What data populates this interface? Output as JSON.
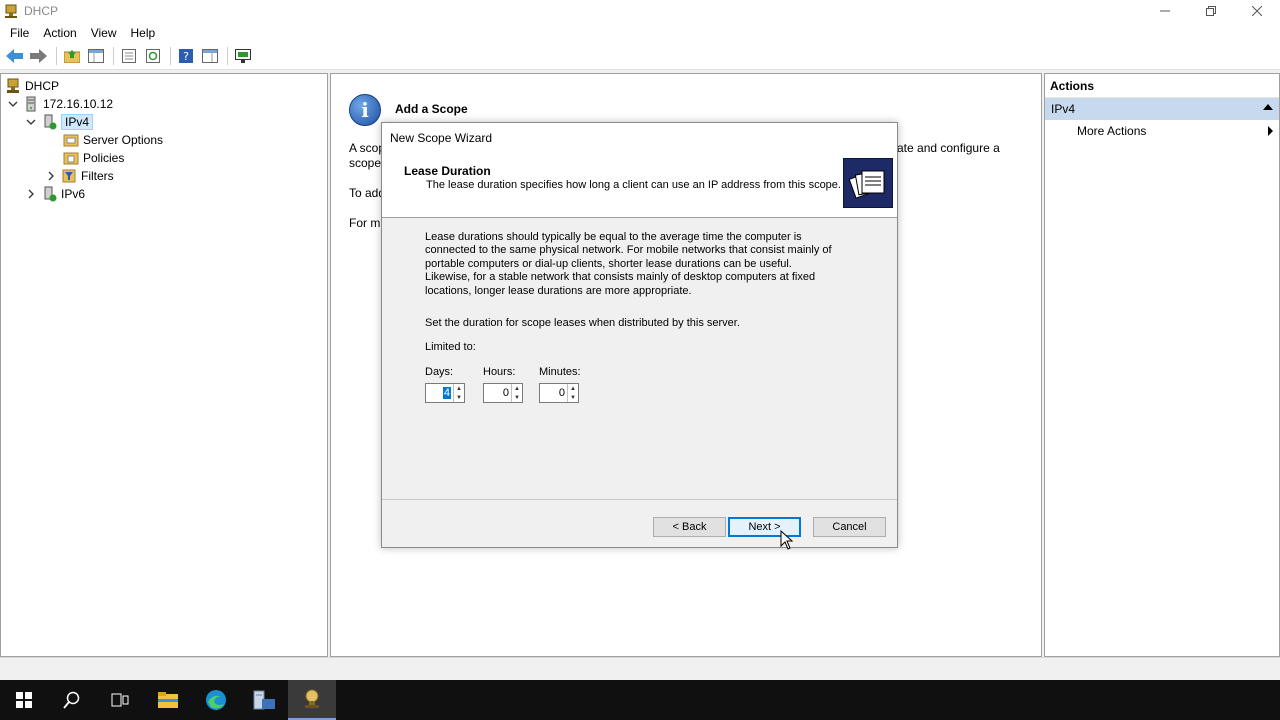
{
  "window": {
    "title": "DHCP",
    "controls": [
      "minimize",
      "restore",
      "close"
    ]
  },
  "menu": [
    "File",
    "Action",
    "View",
    "Help"
  ],
  "toolbar": {
    "buttons": [
      "back-icon",
      "forward-icon",
      "up-folder-icon",
      "show-hide-console-tree-icon",
      "properties-icon",
      "refresh-icon",
      "help-icon",
      "show-hide-action-pane-icon",
      "monitor-icon"
    ]
  },
  "tree": {
    "root": "DHCP",
    "server": "172.16.10.12",
    "ipv4": "IPv4",
    "server_options": "Server Options",
    "policies": "Policies",
    "filters": "Filters",
    "ipv6": "IPv6"
  },
  "center": {
    "title": "Add a Scope",
    "line1_left": "A scop",
    "line1_right": "ate and configure a",
    "line2": "scope",
    "line3": "To add",
    "line4": "For m"
  },
  "actions": {
    "header": "Actions",
    "section": "IPv4",
    "items": [
      "More Actions"
    ]
  },
  "wizard": {
    "caption": "New Scope Wizard",
    "heading": "Lease Duration",
    "subheading": "The lease duration specifies how long a client can use an IP address from this scope.",
    "para": [
      "Lease durations should typically be equal to the average time the computer is",
      "connected to the same physical network. For mobile networks that consist mainly of",
      "portable computers or dial-up clients, shorter lease durations can be useful.",
      "Likewise, for a stable network that consists mainly of desktop computers at fixed",
      "locations, longer lease durations are more appropriate."
    ],
    "set_duration": "Set the duration for scope leases when distributed by this server.",
    "limited_to": "Limited to:",
    "days_label": "Days:",
    "hours_label": "Hours:",
    "minutes_label": "Minutes:",
    "days": "4",
    "hours": "0",
    "minutes": "0",
    "back": "< Back",
    "next": "Next >",
    "cancel": "Cancel"
  },
  "taskbar": {
    "items": [
      "start-icon",
      "search-icon",
      "task-view-icon",
      "file-explorer-icon",
      "edge-icon",
      "server-manager-icon",
      "dhcp-icon"
    ],
    "active": "dhcp-icon"
  },
  "colors": {
    "selection": "#cde8ff",
    "action_section": "#c6d9ef",
    "accent": "#0078d7",
    "wizard_art": "#1d2a66"
  }
}
